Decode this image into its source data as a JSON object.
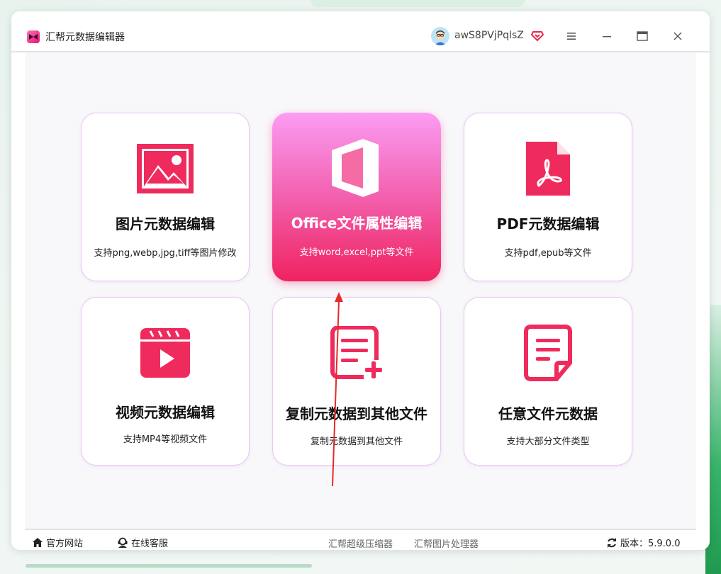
{
  "app": {
    "title": "汇帮元数据编辑器",
    "username": "awS8PVjPqlsZ"
  },
  "colors": {
    "accent": "#f0225f",
    "accent_gradient_top": "#fb9cf3",
    "icon_red": "#ef2b5d"
  },
  "cards": [
    {
      "id": "image",
      "title": "图片元数据编辑",
      "desc": "支持png,webp,jpg,tiff等图片修改",
      "icon": "image-icon"
    },
    {
      "id": "office",
      "title": "Office文件属性编辑",
      "desc": "支持word,excel,ppt等文件",
      "icon": "office-icon",
      "active": true
    },
    {
      "id": "pdf",
      "title": "PDF元数据编辑",
      "desc": "支持pdf,epub等文件",
      "icon": "pdf-icon"
    },
    {
      "id": "video",
      "title": "视频元数据编辑",
      "desc": "支持MP4等视频文件",
      "icon": "video-icon"
    },
    {
      "id": "copy",
      "title": "复制元数据到其他文件",
      "desc": "复制元数据到其他文件",
      "icon": "document-add-icon"
    },
    {
      "id": "any",
      "title": "任意文件元数据",
      "desc": "支持大部分文件类型",
      "icon": "document-icon"
    }
  ],
  "footer": {
    "website": "官方网站",
    "support": "在线客服",
    "link1": "汇帮超级压缩器",
    "link2": "汇帮图片处理器",
    "version": "版本：5.9.0.0"
  }
}
